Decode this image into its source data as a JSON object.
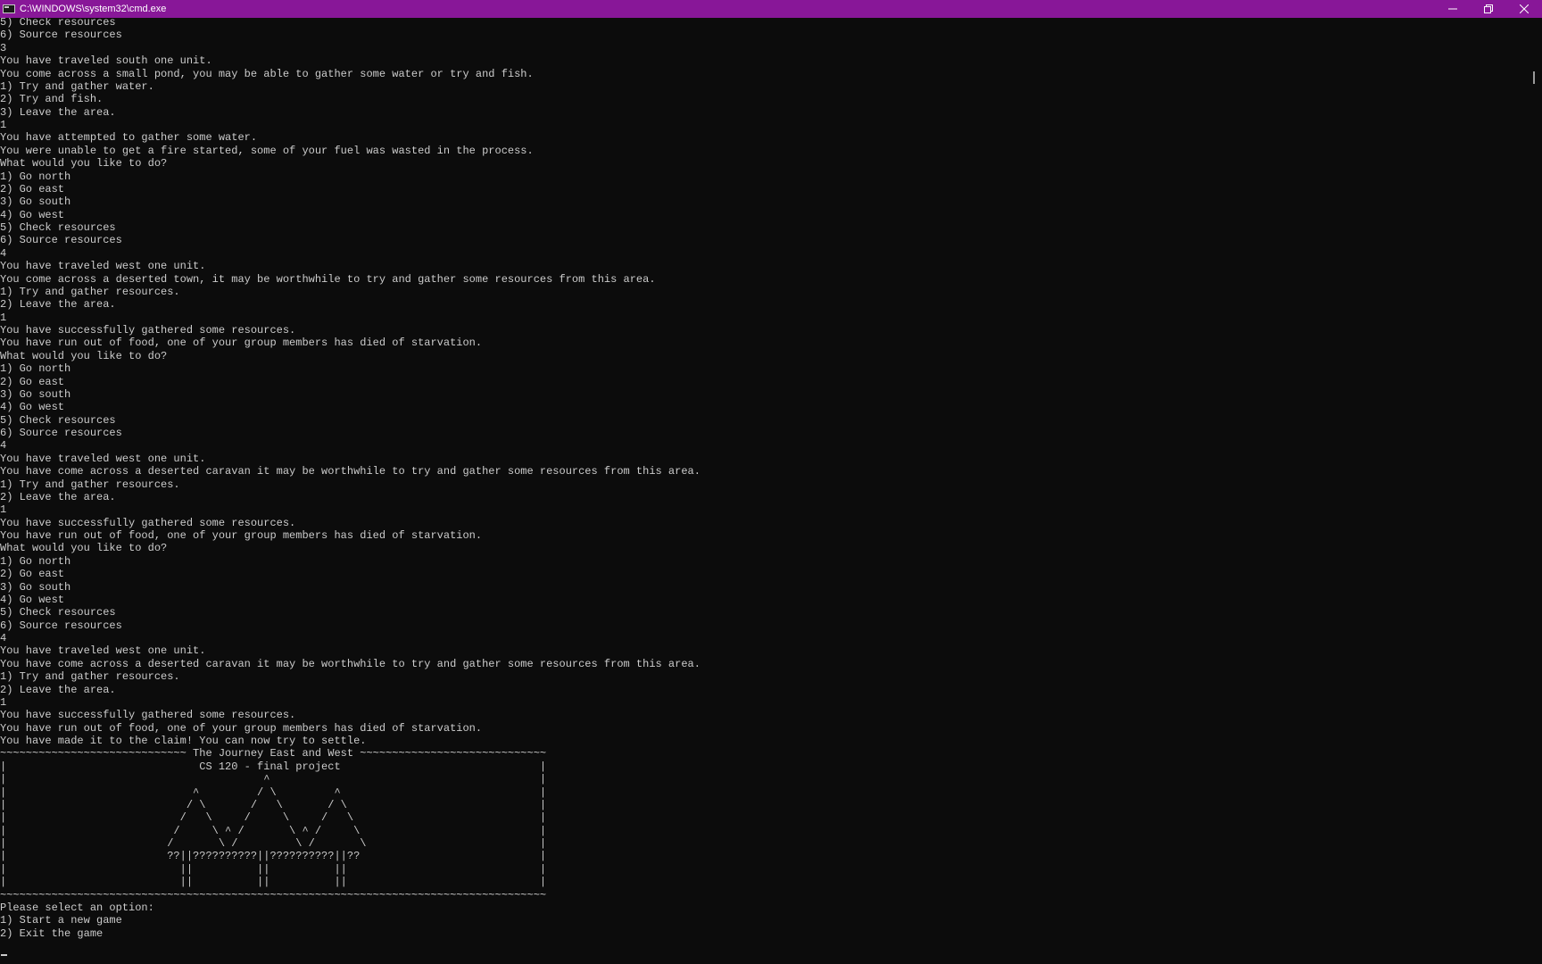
{
  "window": {
    "title": "C:\\WINDOWS\\system32\\cmd.exe",
    "accent_color": "#881798"
  },
  "controls": {
    "minimize_icon": "minimize-icon",
    "maximize_icon": "restore-icon",
    "close_icon": "close-icon"
  },
  "console": {
    "lines": [
      "5) Check resources",
      "6) Source resources",
      "3",
      "You have traveled south one unit.",
      "You come across a small pond, you may be able to gather some water or try and fish.",
      "1) Try and gather water.",
      "2) Try and fish.",
      "3) Leave the area.",
      "1",
      "You have attempted to gather some water.",
      "You were unable to get a fire started, some of your fuel was wasted in the process.",
      "What would you like to do?",
      "1) Go north",
      "2) Go east",
      "3) Go south",
      "4) Go west",
      "5) Check resources",
      "6) Source resources",
      "4",
      "You have traveled west one unit.",
      "You come across a deserted town, it may be worthwhile to try and gather some resources from this area.",
      "1) Try and gather resources.",
      "2) Leave the area.",
      "1",
      "You have successfully gathered some resources.",
      "You have run out of food, one of your group members has died of starvation.",
      "What would you like to do?",
      "1) Go north",
      "2) Go east",
      "3) Go south",
      "4) Go west",
      "5) Check resources",
      "6) Source resources",
      "4",
      "You have traveled west one unit.",
      "You have come across a deserted caravan it may be worthwhile to try and gather some resources from this area.",
      "1) Try and gather resources.",
      "2) Leave the area.",
      "1",
      "You have successfully gathered some resources.",
      "You have run out of food, one of your group members has died of starvation.",
      "What would you like to do?",
      "1) Go north",
      "2) Go east",
      "3) Go south",
      "4) Go west",
      "5) Check resources",
      "6) Source resources",
      "4",
      "You have traveled west one unit.",
      "You have come across a deserted caravan it may be worthwhile to try and gather some resources from this area.",
      "1) Try and gather resources.",
      "2) Leave the area.",
      "1",
      "You have successfully gathered some resources.",
      "You have run out of food, one of your group members has died of starvation.",
      "You have made it to the claim! You can now try to settle.",
      "~~~~~~~~~~~~~~~~~~~~~~~~~~~~~ The Journey East and West ~~~~~~~~~~~~~~~~~~~~~~~~~~~~~",
      "|                              CS 120 - final project                               |",
      "|                                        ^                                          |",
      "|                             ^         / \\         ^                               |",
      "|                            / \\       /   \\       / \\                              |",
      "|                           /   \\     /     \\     /   \\                             |",
      "|                          /     \\ ^ /       \\ ^ /     \\                            |",
      "|                         /       \\ /         \\ /       \\                           |",
      "|                         ??||??????????||??????????||??                            |",
      "|                           ||          ||          ||                              |",
      "|                           ||          ||          ||                              |",
      "~~~~~~~~~~~~~~~~~~~~~~~~~~~~~~~~~~~~~~~~~~~~~~~~~~~~~~~~~~~~~~~~~~~~~~~~~~~~~~~~~~~~~",
      "Please select an option:",
      "1) Start a new game",
      "2) Exit the game"
    ]
  }
}
